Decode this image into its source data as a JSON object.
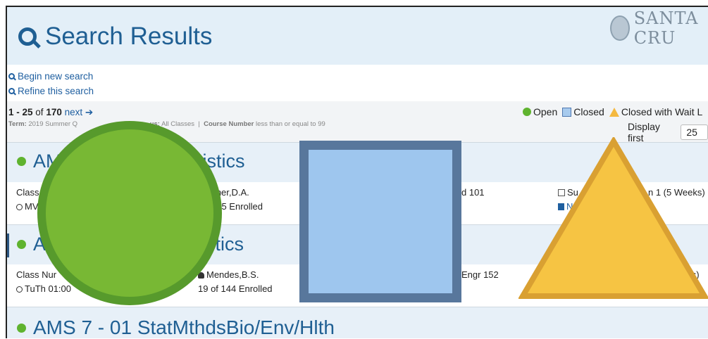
{
  "header": {
    "title": "Search Results",
    "logo_text": "SANTA CRU"
  },
  "links": {
    "new_search": "Begin new search",
    "refine": "Refine this search"
  },
  "pager": {
    "range": "1 - 25",
    "of_label": "of",
    "total": "170",
    "next": "next ➔",
    "term_label": "Term:",
    "term_value": "2019 Summer Q",
    "status_tail": "us:",
    "status_value": "All Classes",
    "course_number_label": "Course Number",
    "course_number_value": "less than or equal to 99"
  },
  "legend": {
    "open": "Open",
    "closed": "Closed",
    "wait": "Closed with Wait L"
  },
  "display": {
    "label": "Display first",
    "value": "25"
  },
  "results": [
    {
      "title_start": "AM",
      "title_end": "tistics",
      "class_label": "Class",
      "time": "MV",
      "instructor": "rsner,D.A.",
      "enrolled": "125 Enrolled",
      "location": "d 101",
      "session": "Su",
      "session_end": "n 1 (5 Weeks)",
      "book": "N"
    },
    {
      "title_start": "A",
      "title_end": "stics",
      "class_label": "Class Nur",
      "time": "TuTh 01:00",
      "instructor": "Mendes,B.S.",
      "enrolled": "19 of 144 Enrolled",
      "location": "Engr 152",
      "session_end": "eks)"
    },
    {
      "title": "AMS 7 - 01   StatMthdsBio/Env/Hlth"
    }
  ],
  "colors": {
    "accent": "#1f5f93",
    "open": "#5fb32f",
    "closed": "#a8cbee",
    "wait": "#f4b940"
  }
}
